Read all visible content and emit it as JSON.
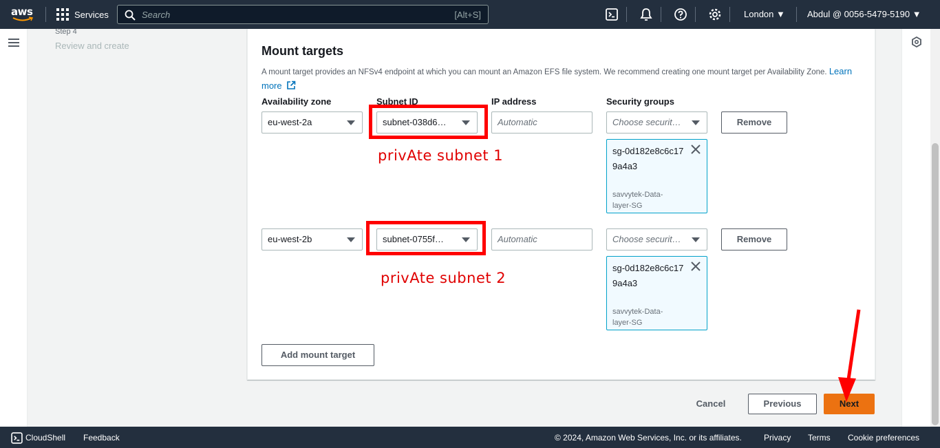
{
  "nav": {
    "logo": "aws",
    "services_label": "Services",
    "search_placeholder": "Search",
    "search_shortcut": "[Alt+S]",
    "region": "London",
    "account": "Abdul @ 0056-5479-5190"
  },
  "steps": {
    "step_label": "Step 4",
    "step_name": "Review and create"
  },
  "mount_targets": {
    "title": "Mount targets",
    "description": "A mount target provides an NFSv4 endpoint at which you can mount an Amazon EFS file system. We recommend creating one mount target per Availability Zone.",
    "learn_more": "Learn more",
    "columns": {
      "az": "Availability zone",
      "subnet": "Subnet ID",
      "ip": "IP address",
      "sg": "Security groups"
    },
    "rows": [
      {
        "az": "eu-west-2a",
        "subnet": "subnet-038d6…",
        "ip_placeholder": "Automatic",
        "sg_placeholder": "Choose securit…",
        "remove_label": "Remove",
        "sg_token_id": "sg-0d182e8c6c179a4a3",
        "sg_token_name": "savvytek-Data-layer-SG",
        "annotation": "privAte subnet 1"
      },
      {
        "az": "eu-west-2b",
        "subnet": "subnet-0755f…",
        "ip_placeholder": "Automatic",
        "sg_placeholder": "Choose securit…",
        "remove_label": "Remove",
        "sg_token_id": "sg-0d182e8c6c179a4a3",
        "sg_token_name": "savvytek-Data-layer-SG",
        "annotation": "privAte subnet 2"
      }
    ],
    "add_button": "Add mount target"
  },
  "actions": {
    "cancel": "Cancel",
    "previous": "Previous",
    "next": "Next"
  },
  "footer": {
    "cloudshell": "CloudShell",
    "feedback": "Feedback",
    "copyright": "© 2024, Amazon Web Services, Inc. or its affiliates.",
    "privacy": "Privacy",
    "terms": "Terms",
    "cookies": "Cookie preferences"
  },
  "colors": {
    "nav_bg": "#232f3e",
    "primary": "#ec7211",
    "link": "#0073bb",
    "annotation": "#ff0000",
    "token_border": "#00a1c9"
  }
}
